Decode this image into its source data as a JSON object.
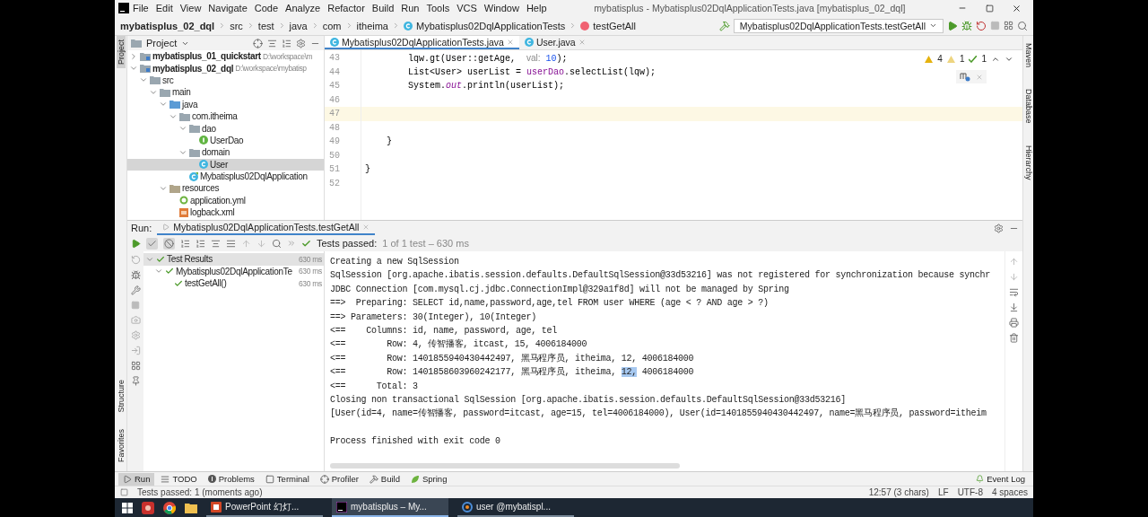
{
  "window": {
    "title": "mybatisplus - Mybatisplus02DqlApplicationTests.java [mybatisplus_02_dql]"
  },
  "menu": [
    "File",
    "Edit",
    "View",
    "Navigate",
    "Code",
    "Analyze",
    "Refactor",
    "Build",
    "Run",
    "Tools",
    "VCS",
    "Window",
    "Help"
  ],
  "breadcrumbs": [
    {
      "label": "mybatisplus_02_dql",
      "kind": "project"
    },
    {
      "label": "src",
      "kind": "plain"
    },
    {
      "label": "test",
      "kind": "plain"
    },
    {
      "label": "java",
      "kind": "plain"
    },
    {
      "label": "com",
      "kind": "plain"
    },
    {
      "label": "itheima",
      "kind": "plain"
    },
    {
      "label": "Mybatisplus02DqlApplicationTests",
      "kind": "class"
    },
    {
      "label": "testGetAll",
      "kind": "method"
    }
  ],
  "run_config": "Mybatisplus02DqlApplicationTests.testGetAll",
  "left_stripe": [
    {
      "label": "Project",
      "selected": true,
      "kind": "top"
    },
    {
      "label": "Structure",
      "selected": false,
      "kind": "bottom"
    },
    {
      "label": "Favorites",
      "selected": false,
      "kind": "bottom"
    }
  ],
  "right_stripe": [
    "Maven",
    "Database",
    "Hierarchy"
  ],
  "project_panel": {
    "title": "Project",
    "tree": [
      {
        "label": "mybatisplus_01_quickstart",
        "path": "D:\\workspace\\m",
        "kind": "module",
        "expanded": false,
        "selected": false
      },
      {
        "label": "mybatisplus_02_dql",
        "path": "D:\\workspace\\mybatisp",
        "kind": "module",
        "expanded": true,
        "selected": false,
        "children": [
          {
            "label": "src",
            "kind": "folder",
            "expanded": true,
            "selected": false,
            "children": [
              {
                "label": "main",
                "kind": "folder",
                "expanded": true,
                "selected": false,
                "children": [
                  {
                    "label": "java",
                    "kind": "source",
                    "expanded": true,
                    "selected": false,
                    "children": [
                      {
                        "label": "com.itheima",
                        "kind": "package",
                        "expanded": true,
                        "selected": false,
                        "children": [
                          {
                            "label": "dao",
                            "kind": "package",
                            "expanded": true,
                            "selected": false,
                            "children": [
                              {
                                "label": "UserDao",
                                "kind": "interface",
                                "selected": false
                              }
                            ]
                          },
                          {
                            "label": "domain",
                            "kind": "package",
                            "expanded": true,
                            "selected": false,
                            "children": [
                              {
                                "label": "User",
                                "kind": "class",
                                "selected": true
                              }
                            ]
                          },
                          {
                            "label": "Mybatisplus02DqlApplication",
                            "kind": "app",
                            "selected": false
                          }
                        ]
                      }
                    ]
                  },
                  {
                    "label": "resources",
                    "kind": "resources",
                    "expanded": true,
                    "selected": false,
                    "children": [
                      {
                        "label": "application.yml",
                        "kind": "yml",
                        "selected": false
                      },
                      {
                        "label": "logback.xml",
                        "kind": "xml",
                        "selected": false
                      }
                    ]
                  }
                ]
              }
            ]
          }
        ]
      }
    ]
  },
  "editor": {
    "tabs": [
      {
        "label": "Mybatisplus02DqlApplicationTests.java",
        "selected": true
      },
      {
        "label": "User.java",
        "selected": false
      }
    ],
    "inspections": [
      {
        "kind": "warning",
        "count": "4"
      },
      {
        "kind": "weak",
        "count": "1"
      },
      {
        "kind": "typo",
        "count": "1"
      }
    ],
    "lines": [
      {
        "number": "43",
        "current": false,
        "tokens": [
          {
            "text": "        lqw.gt(User::getAge,  ",
            "kind": "plain"
          },
          {
            "text": "val:",
            "kind": "hint"
          },
          {
            "text": " 10",
            "kind": "number"
          },
          {
            "text": ");",
            "kind": "plain"
          }
        ]
      },
      {
        "number": "44",
        "current": false,
        "tokens": [
          {
            "text": "        List<User> userList = ",
            "kind": "plain"
          },
          {
            "text": "userDao",
            "kind": "field"
          },
          {
            "text": ".selectList(lqw);",
            "kind": "plain"
          }
        ]
      },
      {
        "number": "45",
        "current": false,
        "tokens": [
          {
            "text": "        System.",
            "kind": "plain"
          },
          {
            "text": "out",
            "kind": "static"
          },
          {
            "text": ".println(userList);",
            "kind": "plain"
          }
        ]
      },
      {
        "number": "46",
        "current": false
      },
      {
        "number": "47",
        "current": true
      },
      {
        "number": "48",
        "current": false
      },
      {
        "number": "49",
        "current": false,
        "tokens": [
          {
            "text": "    }",
            "kind": "plain"
          }
        ]
      },
      {
        "number": "50",
        "current": false
      },
      {
        "number": "51",
        "current": false,
        "tokens": [
          {
            "text": "}",
            "kind": "plain"
          }
        ]
      },
      {
        "number": "52",
        "current": false
      }
    ]
  },
  "run": {
    "title": "Run:",
    "tab": "Mybatisplus02DqlApplicationTests.testGetAll",
    "status": "Tests passed:",
    "status_detail": "1 of 1 test – 630 ms",
    "tests": [
      {
        "label": "Test Results",
        "time": "630 ms",
        "expanded": true,
        "selected": true,
        "children": [
          {
            "label": "Mybatisplus02DqlApplicationTe",
            "time": "630 ms",
            "expanded": true,
            "selected": false,
            "children": [
              {
                "label": "testGetAll()",
                "time": "630 ms",
                "selected": false
              }
            ]
          }
        ]
      }
    ],
    "console": [
      {
        "text": "Creating a new SqlSession"
      },
      {
        "text": "SqlSession [org.apache.ibatis.session.defaults.DefaultSqlSession@33d53216] was not registered for synchronization because synchr"
      },
      {
        "text": "JDBC Connection [com.mysql.cj.jdbc.ConnectionImpl@329a1f8d] will not be managed by Spring"
      },
      {
        "text": "==>  Preparing: SELECT id,name,password,age,tel FROM user WHERE (age < ? AND age > ?)"
      },
      {
        "text": "==> Parameters: 30(Integer), 10(Integer)"
      },
      {
        "text": "<==    Columns: id, name, password, age, tel"
      },
      {
        "text": "<==        Row: 4, 传智播客, itcast, 15, 4006184000"
      },
      {
        "text": "<==        Row: 1401855940430442497, 黑马程序员, itheima, 12, 4006184000"
      },
      {
        "text": "<==        Row: 1401858603960242177, 黑马程序员, itheima, ",
        "selection": "12,",
        "rest": " 4006184000"
      },
      {
        "text": "<==      Total: 3"
      },
      {
        "text": "Closing non transactional SqlSession [org.apache.ibatis.session.defaults.DefaultSqlSession@33d53216]"
      },
      {
        "text": "[User(id=4, name=传智播客, password=itcast, age=15, tel=4006184000), User(id=1401855940430442497, name=黑马程序员, password=itheim"
      }
    ],
    "exit_message": "Process finished with exit code 0"
  },
  "tool_windows": [
    {
      "label": "Run",
      "kind": "run",
      "selected": true
    },
    {
      "label": "TODO",
      "kind": "todo",
      "selected": false
    },
    {
      "label": "Problems",
      "kind": "problems",
      "selected": false
    },
    {
      "label": "Terminal",
      "kind": "terminal",
      "selected": false
    },
    {
      "label": "Profiler",
      "kind": "profiler",
      "selected": false
    },
    {
      "label": "Build",
      "kind": "build",
      "selected": false
    },
    {
      "label": "Spring",
      "kind": "spring",
      "selected": false
    }
  ],
  "event_log": "Event Log",
  "status_bar": {
    "message": "Tests passed: 1 (moments ago)",
    "items": [
      "12:57 (3 chars)",
      "LF",
      "UTF-8",
      "4 spaces"
    ]
  },
  "taskbar": {
    "pinned": [
      {
        "kind": "app"
      },
      {
        "kind": "chrome"
      },
      {
        "kind": "folder"
      }
    ],
    "apps": [
      {
        "label": "PowerPoint 幻灯...",
        "kind": "powerpoint",
        "selected": false
      },
      {
        "label": "mybatisplus – My...",
        "kind": "idea",
        "selected": true
      },
      {
        "label": "user @mybatispl...",
        "kind": "browser",
        "selected": false
      }
    ]
  }
}
